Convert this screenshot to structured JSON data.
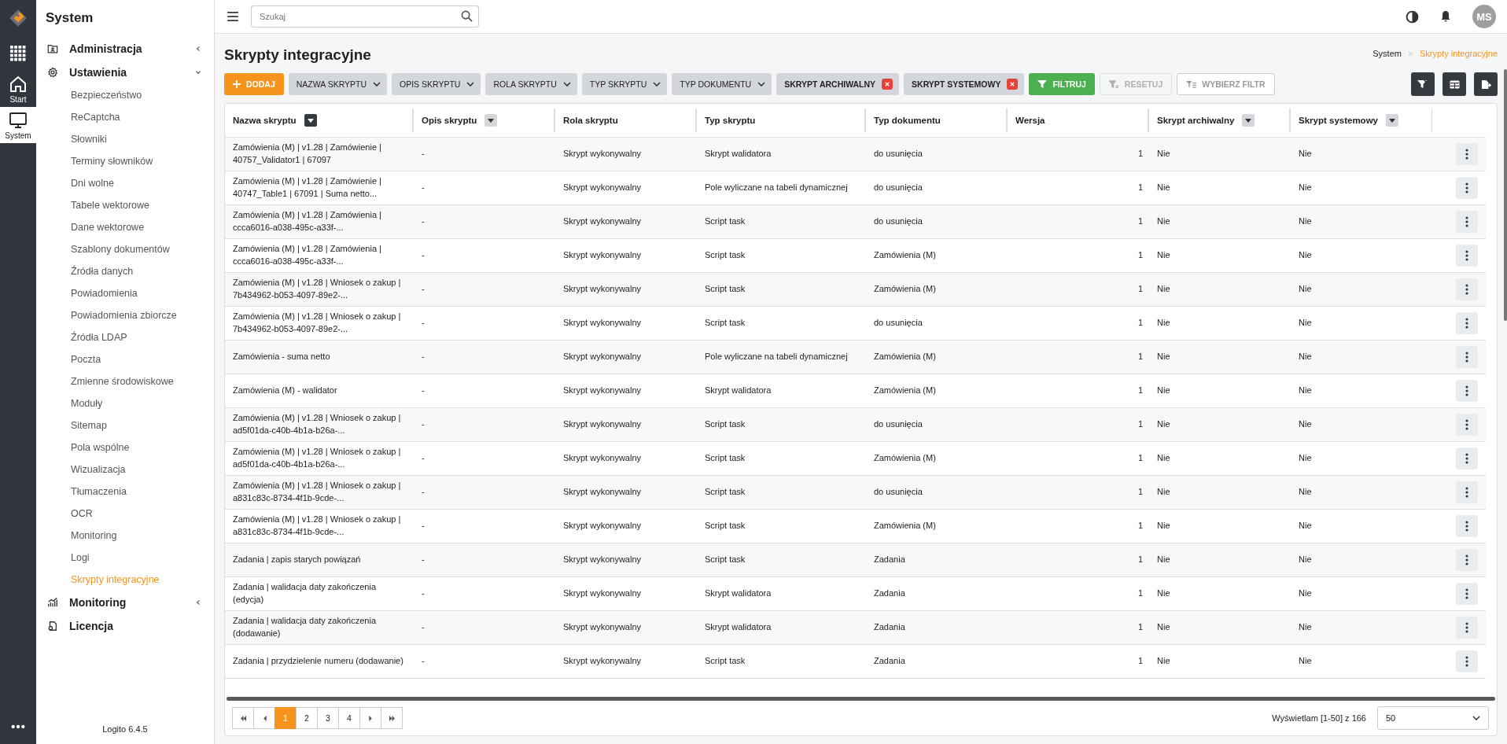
{
  "rail": {
    "items": [
      {
        "kind": "apps",
        "selected": false
      },
      {
        "kind": "home",
        "label": "Start",
        "selected": false
      },
      {
        "kind": "monitor",
        "label": "System",
        "selected": true
      },
      {
        "kind": "more",
        "selected": false
      }
    ]
  },
  "sidebar": {
    "title": "System",
    "version": "Logito 6.4.5",
    "items": [
      {
        "label": "Administracja",
        "expanded": false
      },
      {
        "label": "Ustawienia",
        "expanded": true,
        "children": [
          {
            "label": "Bezpieczeństwo",
            "selected": false
          },
          {
            "label": "ReCaptcha",
            "selected": false
          },
          {
            "label": "Słowniki",
            "selected": false
          },
          {
            "label": "Terminy słowników",
            "selected": false
          },
          {
            "label": "Dni wolne",
            "selected": false
          },
          {
            "label": "Tabele wektorowe",
            "selected": false
          },
          {
            "label": "Dane wektorowe",
            "selected": false
          },
          {
            "label": "Szablony dokumentów",
            "selected": false
          },
          {
            "label": "Źródła danych",
            "selected": false
          },
          {
            "label": "Powiadomienia",
            "selected": false
          },
          {
            "label": "Powiadomienia zbiorcze",
            "selected": false
          },
          {
            "label": "Źródła LDAP",
            "selected": false
          },
          {
            "label": "Poczta",
            "selected": false
          },
          {
            "label": "Zmienne środowiskowe",
            "selected": false
          },
          {
            "label": "Moduły",
            "selected": false
          },
          {
            "label": "Sitemap",
            "selected": false
          },
          {
            "label": "Pola wspólne",
            "selected": false
          },
          {
            "label": "Wizualizacja",
            "selected": false
          },
          {
            "label": "Tłumaczenia",
            "selected": false
          },
          {
            "label": "OCR",
            "selected": false
          },
          {
            "label": "Monitoring",
            "selected": false
          },
          {
            "label": "Logi",
            "selected": false
          },
          {
            "label": "Skrypty integracyjne",
            "selected": true
          }
        ]
      },
      {
        "label": "Monitoring",
        "expanded": false
      },
      {
        "label": "Licencja"
      }
    ]
  },
  "topbar": {
    "search": {
      "placeholder": "Szukaj"
    },
    "avatar": "MS"
  },
  "page": {
    "title": "Skrypty integracyjne",
    "breadcrumb": [
      {
        "label": "System",
        "current": false
      },
      {
        "label": "Skrypty integracyjne",
        "current": true
      }
    ]
  },
  "toolbar": {
    "add": "DODAJ",
    "filters": [
      {
        "kind": "dropdown",
        "label": "NAZWA SKRYPTU"
      },
      {
        "kind": "dropdown",
        "label": "OPIS SKRYPTU"
      },
      {
        "kind": "dropdown",
        "label": "ROLA SKRYPTU"
      },
      {
        "kind": "dropdown",
        "label": "TYP SKRYPTU"
      },
      {
        "kind": "dropdown",
        "label": "TYP DOKUMENTU"
      },
      {
        "kind": "removable",
        "label": "SKRYPT ARCHIWALNY"
      },
      {
        "kind": "removable",
        "label": "SKRYPT SYSTEMOWY"
      }
    ],
    "actions": [
      {
        "kind": "filter",
        "label": "FILTRUJ",
        "disabled": false
      },
      {
        "kind": "reset",
        "label": "RESETUJ",
        "disabled": true
      },
      {
        "kind": "choose",
        "label": "WYBIERZ FILTR",
        "disabled": false
      }
    ],
    "tools": [
      {
        "kind": "clear-filter"
      },
      {
        "kind": "columns"
      },
      {
        "kind": "export"
      }
    ]
  },
  "table": {
    "columns": [
      {
        "label": "Nazwa skryptu",
        "kind": "filterable",
        "filter_active": true
      },
      {
        "label": "Opis skryptu",
        "kind": "filterable",
        "filter_active": false
      },
      {
        "label": "Rola skryptu",
        "kind": "plain"
      },
      {
        "label": "Typ skryptu",
        "kind": "plain"
      },
      {
        "label": "Typ dokumentu",
        "kind": "plain"
      },
      {
        "label": "Wersja",
        "kind": "plain"
      },
      {
        "label": "Skrypt archiwalny",
        "kind": "filterable",
        "filter_active": false
      },
      {
        "label": "Skrypt systemowy",
        "kind": "filterable",
        "filter_active": false
      }
    ],
    "rows": [
      [
        "Zamówienia (M) | v1.28 | Zamówienie | 40757_Validator1 | 67097",
        "-",
        "Skrypt wykonywalny",
        "Skrypt walidatora",
        "do usunięcia",
        "1",
        "Nie",
        "Nie"
      ],
      [
        "Zamówienia (M) | v1.28 | Zamówienie | 40747_Table1 | 67091 | Suma netto...",
        "-",
        "Skrypt wykonywalny",
        "Pole wyliczane na tabeli dynamicznej",
        "do usunięcia",
        "1",
        "Nie",
        "Nie"
      ],
      [
        "Zamówienia (M) | v1.28 | Zamówienia | ccca6016-a038-495c-a33f-...",
        "-",
        "Skrypt wykonywalny",
        "Script task",
        "do usunięcia",
        "1",
        "Nie",
        "Nie"
      ],
      [
        "Zamówienia (M) | v1.28 | Zamówienia | ccca6016-a038-495c-a33f-...",
        "-",
        "Skrypt wykonywalny",
        "Script task",
        "Zamówienia (M)",
        "1",
        "Nie",
        "Nie"
      ],
      [
        "Zamówienia (M) | v1.28 | Wniosek o zakup | 7b434962-b053-4097-89e2-...",
        "-",
        "Skrypt wykonywalny",
        "Script task",
        "Zamówienia (M)",
        "1",
        "Nie",
        "Nie"
      ],
      [
        "Zamówienia (M) | v1.28 | Wniosek o zakup | 7b434962-b053-4097-89e2-...",
        "-",
        "Skrypt wykonywalny",
        "Script task",
        "do usunięcia",
        "1",
        "Nie",
        "Nie"
      ],
      [
        "Zamówienia - suma netto",
        "-",
        "Skrypt wykonywalny",
        "Pole wyliczane na tabeli dynamicznej",
        "Zamówienia (M)",
        "1",
        "Nie",
        "Nie"
      ],
      [
        "Zamówienia (M) - walidator",
        "-",
        "Skrypt wykonywalny",
        "Skrypt walidatora",
        "Zamówienia (M)",
        "1",
        "Nie",
        "Nie"
      ],
      [
        "Zamówienia (M) | v1.28 | Wniosek o zakup | ad5f01da-c40b-4b1a-b26a-...",
        "-",
        "Skrypt wykonywalny",
        "Script task",
        "do usunięcia",
        "1",
        "Nie",
        "Nie"
      ],
      [
        "Zamówienia (M) | v1.28 | Wniosek o zakup | ad5f01da-c40b-4b1a-b26a-...",
        "-",
        "Skrypt wykonywalny",
        "Script task",
        "Zamówienia (M)",
        "1",
        "Nie",
        "Nie"
      ],
      [
        "Zamówienia (M) | v1.28 | Wniosek o zakup | a831c83c-8734-4f1b-9cde-...",
        "-",
        "Skrypt wykonywalny",
        "Script task",
        "do usunięcia",
        "1",
        "Nie",
        "Nie"
      ],
      [
        "Zamówienia (M) | v1.28 | Wniosek o zakup | a831c83c-8734-4f1b-9cde-...",
        "-",
        "Skrypt wykonywalny",
        "Script task",
        "Zamówienia (M)",
        "1",
        "Nie",
        "Nie"
      ],
      [
        "Zadania | zapis starych powiązań",
        "-",
        "Skrypt wykonywalny",
        "Script task",
        "Zadania",
        "1",
        "Nie",
        "Nie"
      ],
      [
        "Zadania | walidacja daty zakończenia (edycja)",
        "-",
        "Skrypt wykonywalny",
        "Skrypt walidatora",
        "Zadania",
        "1",
        "Nie",
        "Nie"
      ],
      [
        "Zadania | walidacja daty zakończenia (dodawanie)",
        "-",
        "Skrypt wykonywalny",
        "Skrypt walidatora",
        "Zadania",
        "1",
        "Nie",
        "Nie"
      ],
      [
        "Zadania | przydzielenie numeru (dodawanie)",
        "-",
        "Skrypt wykonywalny",
        "Script task",
        "Zadania",
        "1",
        "Nie",
        "Nie"
      ]
    ]
  },
  "pagination": {
    "pages": [
      {
        "label": "1",
        "selected": true
      },
      {
        "label": "2",
        "selected": false
      },
      {
        "label": "3",
        "selected": false
      },
      {
        "label": "4",
        "selected": false
      }
    ],
    "summary": "Wyświetlam [1-50] z 166",
    "page_size": "50"
  }
}
